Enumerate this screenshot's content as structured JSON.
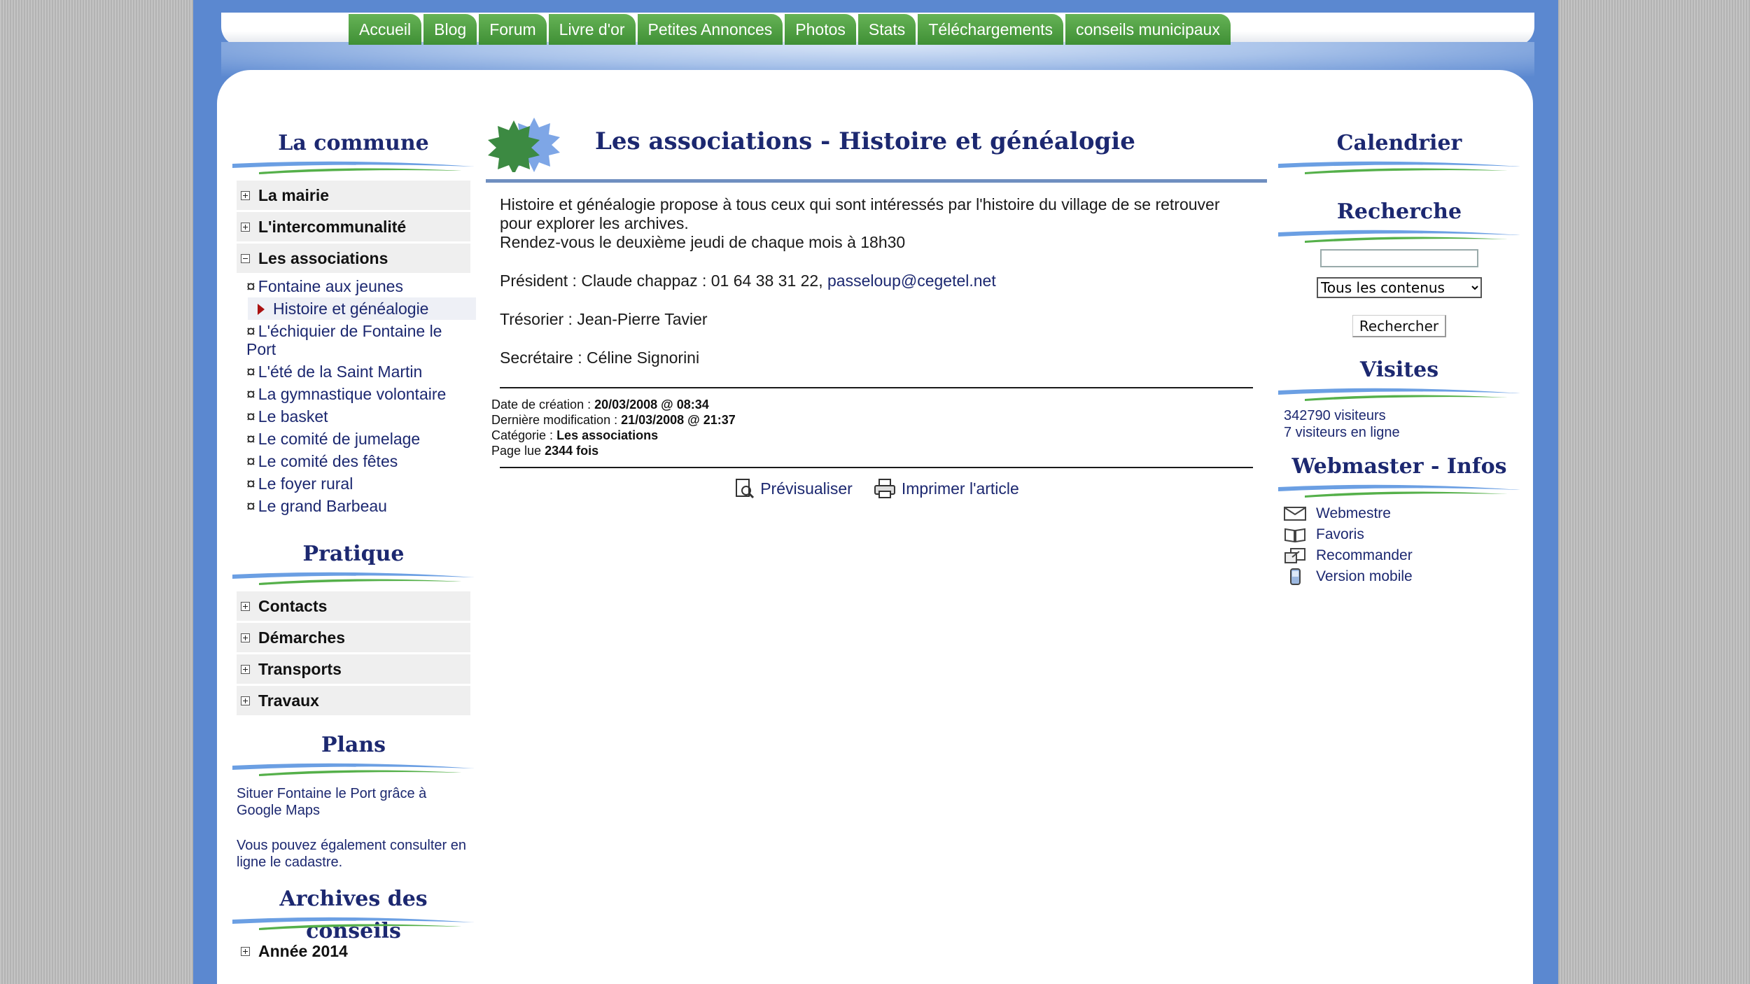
{
  "nav": [
    "Accueil",
    "Blog",
    "Forum",
    "Livre d'or",
    "Petites Annonces",
    "Photos",
    "Stats",
    "Téléchargements",
    "conseils municipaux"
  ],
  "left": {
    "commune_title": "La commune",
    "commune_menu": [
      "La mairie",
      "L'intercommunalité",
      "Les associations"
    ],
    "associations": [
      "Fontaine aux jeunes",
      "Histoire et généalogie",
      "L'échiquier de Fontaine le Port",
      "L'été de la Saint Martin",
      "La gymnastique volontaire",
      "Le basket",
      "Le comité de jumelage",
      "Le comité des fêtes",
      "Le foyer rural",
      "Le grand Barbeau"
    ],
    "bullet": "¤",
    "pratique_title": "Pratique",
    "pratique_menu": [
      "Contacts",
      "Démarches",
      "Transports",
      "Travaux"
    ],
    "plans_title": "Plans",
    "plans_text1": "Situer Fontaine le Port grâce à Google Maps",
    "plans_text2": "Vous pouvez également consulter en ligne le cadastre.",
    "archives_title": "Archives des conseils",
    "archives_item": "Année 2014"
  },
  "article": {
    "title": "Les associations - Histoire et généalogie",
    "intro": "Histoire et généalogie propose à tous ceux qui sont intéressés par l'histoire du village de se retrouver pour explorer les archives.",
    "intro2": "Rendez-vous le deuxième jeudi de chaque mois à 18h30",
    "president_label": "Président : Claude chappaz : 01 64 38 31 22, ",
    "president_email": "passeloup@cegetel.net",
    "tresorier": "Trésorier : Jean-Pierre Tavier",
    "secretaire": "Secrétaire : Céline Signorini",
    "meta": {
      "created_label": "Date de création : ",
      "created": "20/03/2008 @ 08:34",
      "modified_label": "Dernière modification : ",
      "modified": "21/03/2008 @ 21:37",
      "category_label": "Catégorie : ",
      "category": "Les associations",
      "read_label": "Page lue ",
      "read": "2344 fois"
    },
    "preview": "Prévisualiser",
    "print": "Imprimer l'article"
  },
  "right": {
    "calendar_title": "Calendrier",
    "search_title": "Recherche",
    "search_value": "",
    "search_option": "Tous les contenus",
    "search_button": "Rechercher",
    "visits_title": "Visites",
    "visitors": "342790 visiteurs",
    "online": "7 visiteurs en ligne",
    "webmaster_title": "Webmaster - Infos",
    "links": [
      "Webmestre",
      "Favoris",
      "Recommander",
      "Version mobile"
    ]
  }
}
